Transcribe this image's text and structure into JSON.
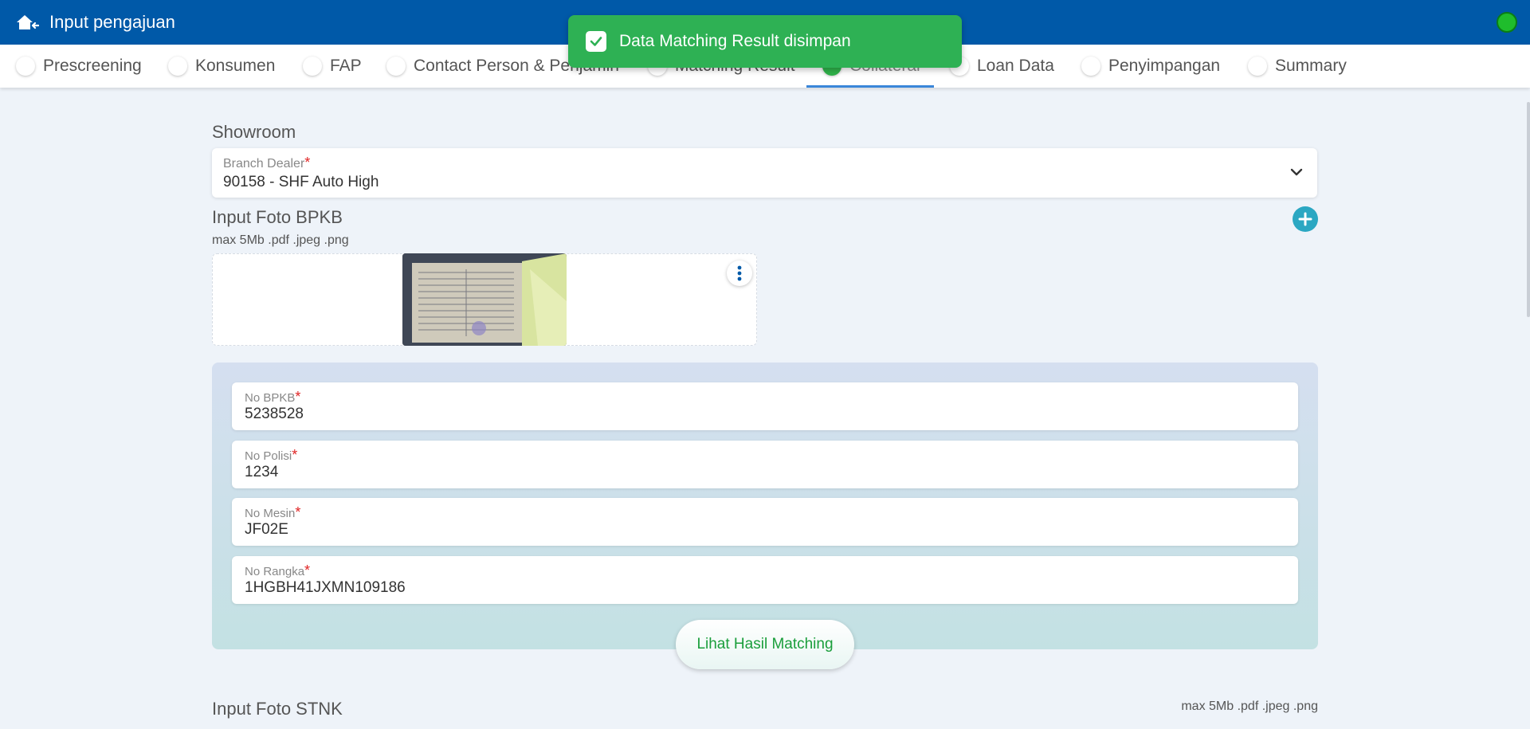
{
  "header": {
    "title": "Input pengajuan",
    "home_icon": "home-back-icon",
    "status_color": "#1fbd2c"
  },
  "toast": {
    "message": "Data Matching Result disimpan",
    "color": "#2eb154"
  },
  "tabs": [
    {
      "label": "Prescreening",
      "active": false
    },
    {
      "label": "Konsumen",
      "active": false
    },
    {
      "label": "FAP",
      "active": false
    },
    {
      "label": "Contact Person & Penjamin",
      "active": false
    },
    {
      "label": "Matching Result",
      "active": false
    },
    {
      "label": "Collateral",
      "active": true
    },
    {
      "label": "Loan Data",
      "active": false
    },
    {
      "label": "Penyimpangan",
      "active": false
    },
    {
      "label": "Summary",
      "active": false
    }
  ],
  "showroom": {
    "title": "Showroom",
    "branch_dealer": {
      "label": "Branch Dealer",
      "required_mark": "*",
      "value": "90158 - SHF Auto High"
    }
  },
  "bpkb": {
    "title": "Input Foto BPKB",
    "hint": "max 5Mb .pdf .jpeg .png",
    "fields": [
      {
        "label": "No BPKB",
        "required_mark": "*",
        "value": "5238528"
      },
      {
        "label": "No Polisi",
        "required_mark": "*",
        "value": "1234"
      },
      {
        "label": "No Mesin",
        "required_mark": "*",
        "value": "JF02E"
      },
      {
        "label": "No Rangka",
        "required_mark": "*",
        "value": "1HGBH41JXMN109186"
      }
    ],
    "match_button": "Lihat Hasil Matching"
  },
  "stnk": {
    "title": "Input Foto STNK",
    "hint": "max 5Mb .pdf .jpeg .png"
  }
}
